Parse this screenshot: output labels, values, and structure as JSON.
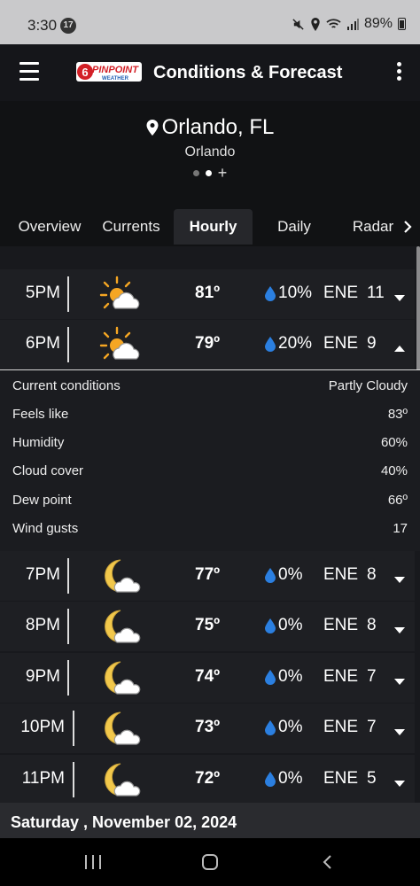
{
  "status": {
    "time": "3:30",
    "notification_count": "17",
    "battery": "89%",
    "icons": [
      "mute-icon",
      "location-icon",
      "wifi-icon",
      "signal-icon",
      "battery-icon"
    ]
  },
  "app": {
    "title": "Conditions & Forecast",
    "logo_text": "PINPOINT",
    "logo_sub": "WEATHER",
    "logo_number": "6",
    "accent": "#d32027",
    "logo_blue": "#1f5fb4"
  },
  "location": {
    "name": "Orlando, FL",
    "subtitle": "Orlando",
    "pages": 2,
    "active_page": 1,
    "add_symbol": "+"
  },
  "tabs": [
    {
      "label": "Overview"
    },
    {
      "label": "Currents"
    },
    {
      "label": "Hourly",
      "active": true
    },
    {
      "label": "Daily"
    },
    {
      "label": "Radar"
    }
  ],
  "hourly": [
    {
      "time": "5PM",
      "icon": "partly-sunny-icon",
      "temp": "81º",
      "precip": "10%",
      "wind_dir": "ENE",
      "wind_speed": "11",
      "expanded": false
    },
    {
      "time": "6PM",
      "icon": "partly-sunny-icon",
      "temp": "79º",
      "precip": "20%",
      "wind_dir": "ENE",
      "wind_speed": "9",
      "expanded": true
    },
    {
      "time": "7PM",
      "icon": "partly-cloudy-night-icon",
      "temp": "77º",
      "precip": "0%",
      "wind_dir": "ENE",
      "wind_speed": "8",
      "expanded": false
    },
    {
      "time": "8PM",
      "icon": "partly-cloudy-night-icon",
      "temp": "75º",
      "precip": "0%",
      "wind_dir": "ENE",
      "wind_speed": "8",
      "expanded": false
    },
    {
      "time": "9PM",
      "icon": "partly-cloudy-night-icon",
      "temp": "74º",
      "precip": "0%",
      "wind_dir": "ENE",
      "wind_speed": "7",
      "expanded": false
    },
    {
      "time": "10PM",
      "icon": "partly-cloudy-night-icon",
      "temp": "73º",
      "precip": "0%",
      "wind_dir": "ENE",
      "wind_speed": "7",
      "expanded": false
    },
    {
      "time": "11PM",
      "icon": "partly-cloudy-night-icon",
      "temp": "72º",
      "precip": "0%",
      "wind_dir": "ENE",
      "wind_speed": "5",
      "expanded": false
    }
  ],
  "details": [
    {
      "label": "Current conditions",
      "value": "Partly Cloudy"
    },
    {
      "label": "Feels like",
      "value": "83º"
    },
    {
      "label": "Humidity",
      "value": "60%"
    },
    {
      "label": "Cloud cover",
      "value": "40%"
    },
    {
      "label": "Dew point",
      "value": "66º"
    },
    {
      "label": "Wind gusts",
      "value": "17"
    }
  ],
  "date_header": "Saturday , November 02, 2024",
  "colors": {
    "drop": "#2b7fe0",
    "sun": "#f5a623",
    "moon": "#f2c84b"
  }
}
